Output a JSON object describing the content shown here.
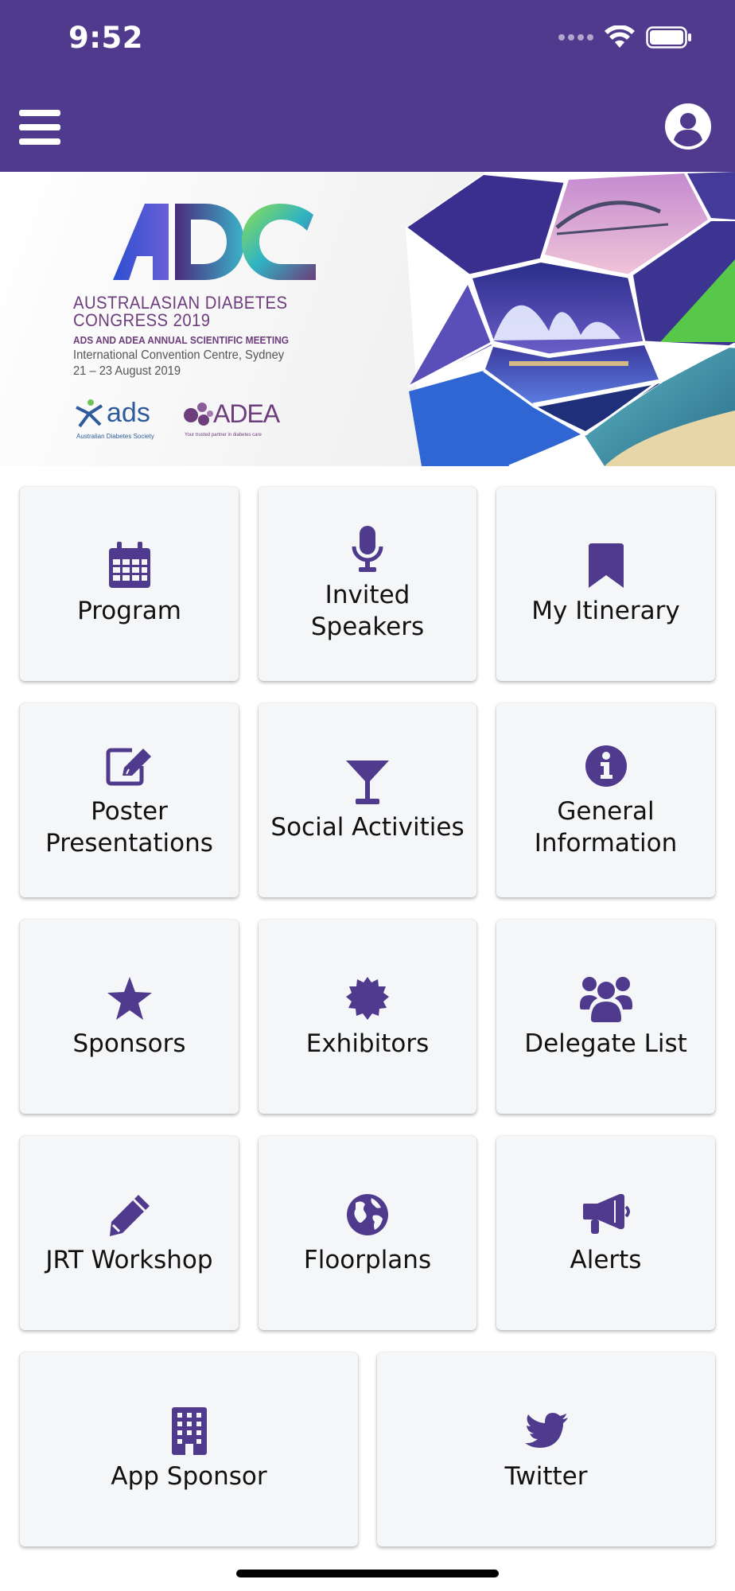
{
  "status_bar": {
    "time": "9:52"
  },
  "app_bar": {
    "menu_icon": "hamburger-menu-icon",
    "profile_icon": "user-circle-icon"
  },
  "banner": {
    "logo_text": "ADC",
    "congress_title_1": "AUSTRALASIAN DIABETES",
    "congress_title_2": "CONGRESS 2019",
    "meeting": "ADS AND ADEA ANNUAL SCIENTIFIC MEETING",
    "venue": "International Convention Centre, Sydney",
    "dates": "21 – 23 August 2019",
    "ads_logo": "ads",
    "ads_sub": "Australian Diabetes Society",
    "adea_logo": "ADEA",
    "adea_sub": "Your trusted partner in diabetes care"
  },
  "colors": {
    "brand_purple": "#4f3a8d",
    "icon_purple": "#4f3a8d",
    "tile_bg": "#f5f6f8"
  },
  "tiles": [
    {
      "label": "Program",
      "icon": "calendar-icon"
    },
    {
      "label": "Invited\nSpeakers",
      "icon": "microphone-icon"
    },
    {
      "label": "My Itinerary",
      "icon": "bookmark-icon"
    },
    {
      "label": "Poster\nPresentations",
      "icon": "edit-icon"
    },
    {
      "label": "Social Activities",
      "icon": "cocktail-icon"
    },
    {
      "label": "General\nInformation",
      "icon": "info-icon"
    },
    {
      "label": "Sponsors",
      "icon": "star-icon"
    },
    {
      "label": "Exhibitors",
      "icon": "certificate-icon"
    },
    {
      "label": "Delegate List",
      "icon": "users-icon"
    },
    {
      "label": "JRT Workshop",
      "icon": "pencil-icon"
    },
    {
      "label": "Floorplans",
      "icon": "globe-icon"
    },
    {
      "label": "Alerts",
      "icon": "megaphone-icon"
    },
    {
      "label": "App Sponsor",
      "icon": "building-icon"
    },
    {
      "label": "Twitter",
      "icon": "twitter-icon"
    }
  ]
}
